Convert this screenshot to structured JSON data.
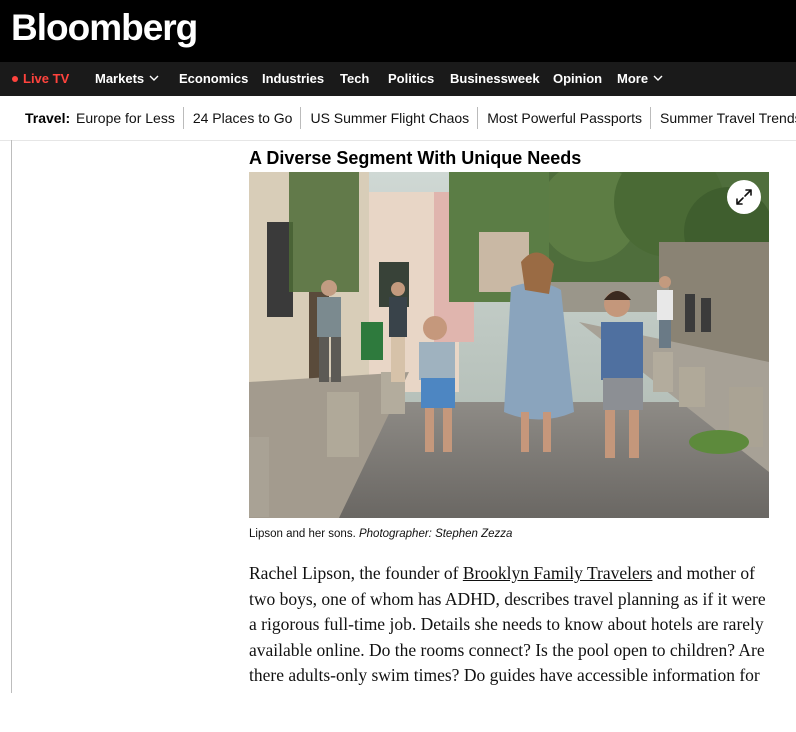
{
  "header": {
    "logo": "Bloomberg"
  },
  "nav": {
    "live": "Live TV",
    "items": [
      "Markets",
      "Economics",
      "Industries",
      "Tech",
      "Politics",
      "Businessweek",
      "Opinion",
      "More"
    ]
  },
  "travel": {
    "label": "Travel:",
    "links": [
      "Europe for Less",
      "24 Places to Go",
      "US Summer Flight Chaos",
      "Most Powerful Passports",
      "Summer Travel Trends"
    ]
  },
  "article": {
    "headline": "A Diverse Segment With Unique Needs",
    "caption_main": "Lipson and her sons.",
    "caption_credit": "Photographer: Stephen Zezza",
    "p1_before": "Rachel Lipson, the founder of ",
    "p1_link": "Brooklyn Family Travelers",
    "p1_after": " and mother of two boys, one of whom has ADHD, describes travel planning as if it were a rigorous full-time job. Details she needs to know about hotels are rarely available online. Do the rooms connect? Is the pool open to children? Are there adults-only swim times? Do guides have accessible information for infant and children alike?"
  },
  "colors": {
    "brand_black": "#000000",
    "live_red": "#ff433d",
    "nav_bg": "#1a1a1a"
  },
  "icons": {
    "expand": "expand-icon",
    "live": "live-dot-icon",
    "dropdown": "chevron-down-icon"
  }
}
